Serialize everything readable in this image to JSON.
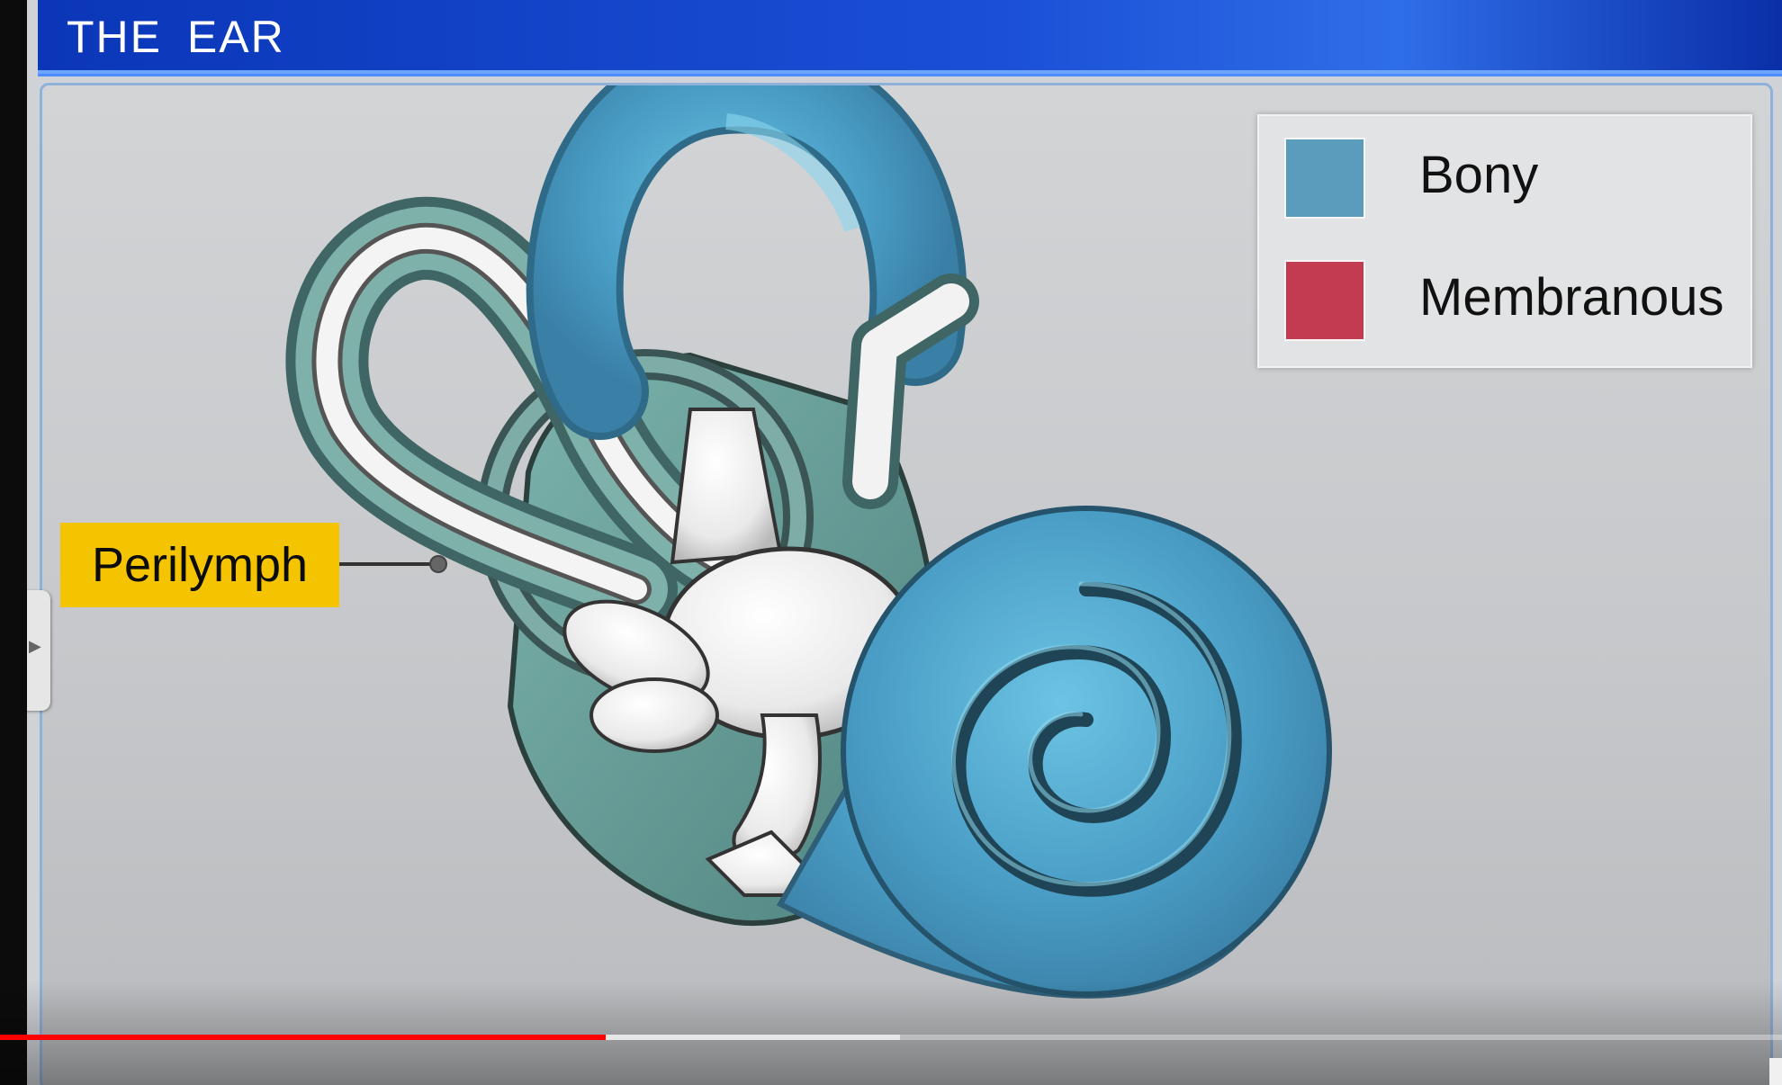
{
  "window": {
    "title": "THE  EAR"
  },
  "legend": {
    "items": [
      {
        "label": "Bony",
        "color": "#5b9cbd"
      },
      {
        "label": "Membranous",
        "color": "#c23b50"
      }
    ]
  },
  "callout": {
    "label": "Perilymph",
    "color": "#f5c400"
  },
  "video": {
    "progress_played": 0.34,
    "progress_buffered": 0.505
  },
  "colors": {
    "title_bar": "#1a4fd6",
    "bony_texture": "#4fa3c9",
    "perilymph_shell": "#5f9591"
  }
}
